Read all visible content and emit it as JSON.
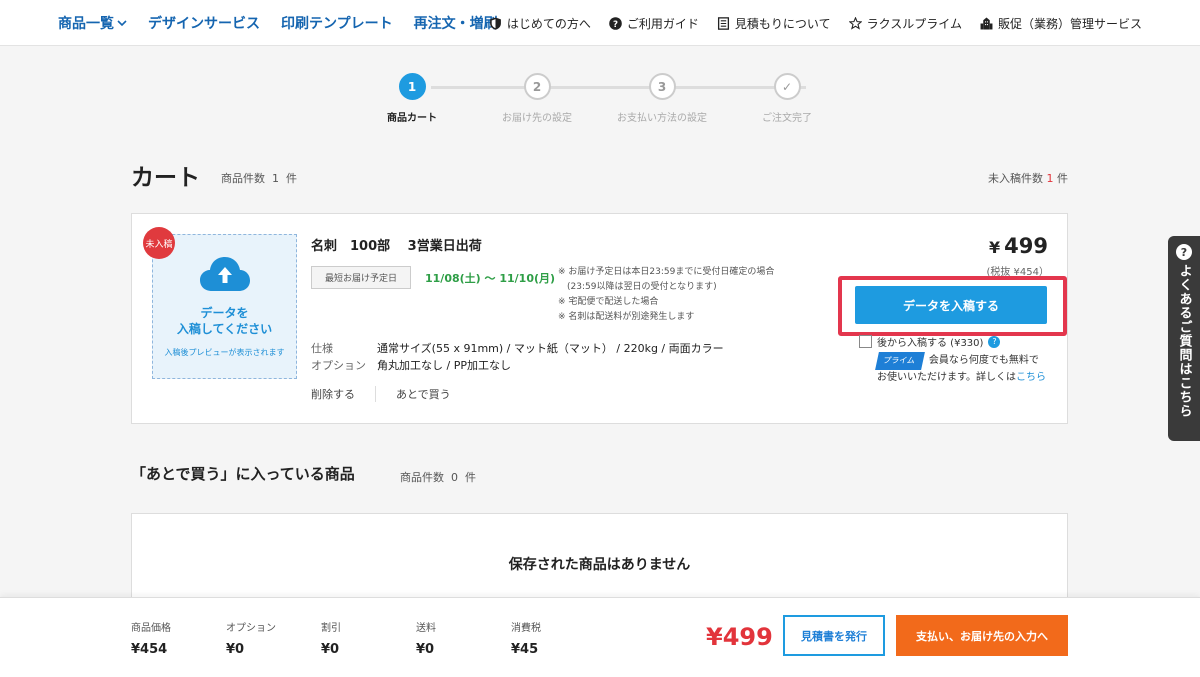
{
  "nav": {
    "left": [
      {
        "label": "商品一覧"
      },
      {
        "label": "デザインサービス"
      },
      {
        "label": "印刷テンプレート"
      },
      {
        "label": "再注文・増刷"
      }
    ],
    "right": [
      {
        "label": "はじめての方へ",
        "icon": "shield-icon"
      },
      {
        "label": "ご利用ガイド",
        "icon": "question-icon"
      },
      {
        "label": "見積もりについて",
        "icon": "document-icon"
      },
      {
        "label": "ラクスルプライム",
        "icon": "star-icon"
      },
      {
        "label": "販促（業務）管理サービス",
        "icon": "building-icon"
      }
    ]
  },
  "stepper": {
    "steps": [
      {
        "num": "1",
        "label": "商品カート",
        "active": true
      },
      {
        "num": "2",
        "label": "お届け先の設定",
        "active": false
      },
      {
        "num": "3",
        "label": "お支払い方法の設定",
        "active": false
      },
      {
        "num": "✓",
        "label": "ご注文完了",
        "active": false
      }
    ]
  },
  "cart": {
    "title": "カート",
    "count_label": "商品件数",
    "count": "1",
    "count_unit": "件",
    "unsubmitted_label": "未入稿件数",
    "unsubmitted_count": "1",
    "unsubmitted_unit": "件"
  },
  "item": {
    "badge": "未入稿",
    "upload_text_1": "データを",
    "upload_text_2": "入稿してください",
    "upload_sub": "入稿後プレビューが表示されます",
    "name": "名刺　100部　 3営業日出荷",
    "delivery_label": "最短お届け予定日",
    "delivery_dates": "11/08(土) 〜 11/10(月)",
    "notes": [
      "※ お届け予定日は本日23:59までに受付日確定の場合",
      "　(23:59以降は翌日の受付となります)",
      "※ 宅配便で配送した場合",
      "※ 名刺は配送料が別途発生します"
    ],
    "spec_label": "仕様",
    "spec_value": "通常サイズ(55 x 91mm) / マット紙（マット） / 220kg / 両面カラー",
    "option_label": "オプション",
    "option_value": "角丸加工なし / PP加工なし",
    "delete": "削除する",
    "save_later": "あとで買う",
    "price_symbol": "¥",
    "price": "499",
    "price_ex": "(税抜 ¥454）",
    "submit_button": "データを入稿する",
    "later_submit": "後から入稿する (¥330)",
    "prime_tag": "プライム",
    "prime_text_1": "会員なら何度でも無料で",
    "prime_text_2": "お使いいただけます。詳しくは",
    "prime_link": "こちら"
  },
  "later_section": {
    "title": "「あとで買う」に入っている商品",
    "count_label": "商品件数",
    "count": "0",
    "count_unit": "件",
    "empty": "保存された商品はありません"
  },
  "summary": {
    "items": [
      {
        "label": "商品価格",
        "value": "¥454"
      },
      {
        "label": "オプション",
        "value": "¥0"
      },
      {
        "label": "割引",
        "value": "¥0"
      },
      {
        "label": "送料",
        "value": "¥0"
      },
      {
        "label": "消費税",
        "value": "¥45"
      }
    ],
    "total": "¥499",
    "quote_button": "見積書を発行",
    "pay_button": "支払い、お届け先の入力へ"
  },
  "side_tab": {
    "q": "?",
    "text": "よくあるご質問はこちら"
  },
  "colors": {
    "brand_blue": "#1e9be0",
    "nav_blue": "#1565b0",
    "accent_red": "#e2343b",
    "orange": "#f26a1b",
    "green": "#2e9e46"
  }
}
